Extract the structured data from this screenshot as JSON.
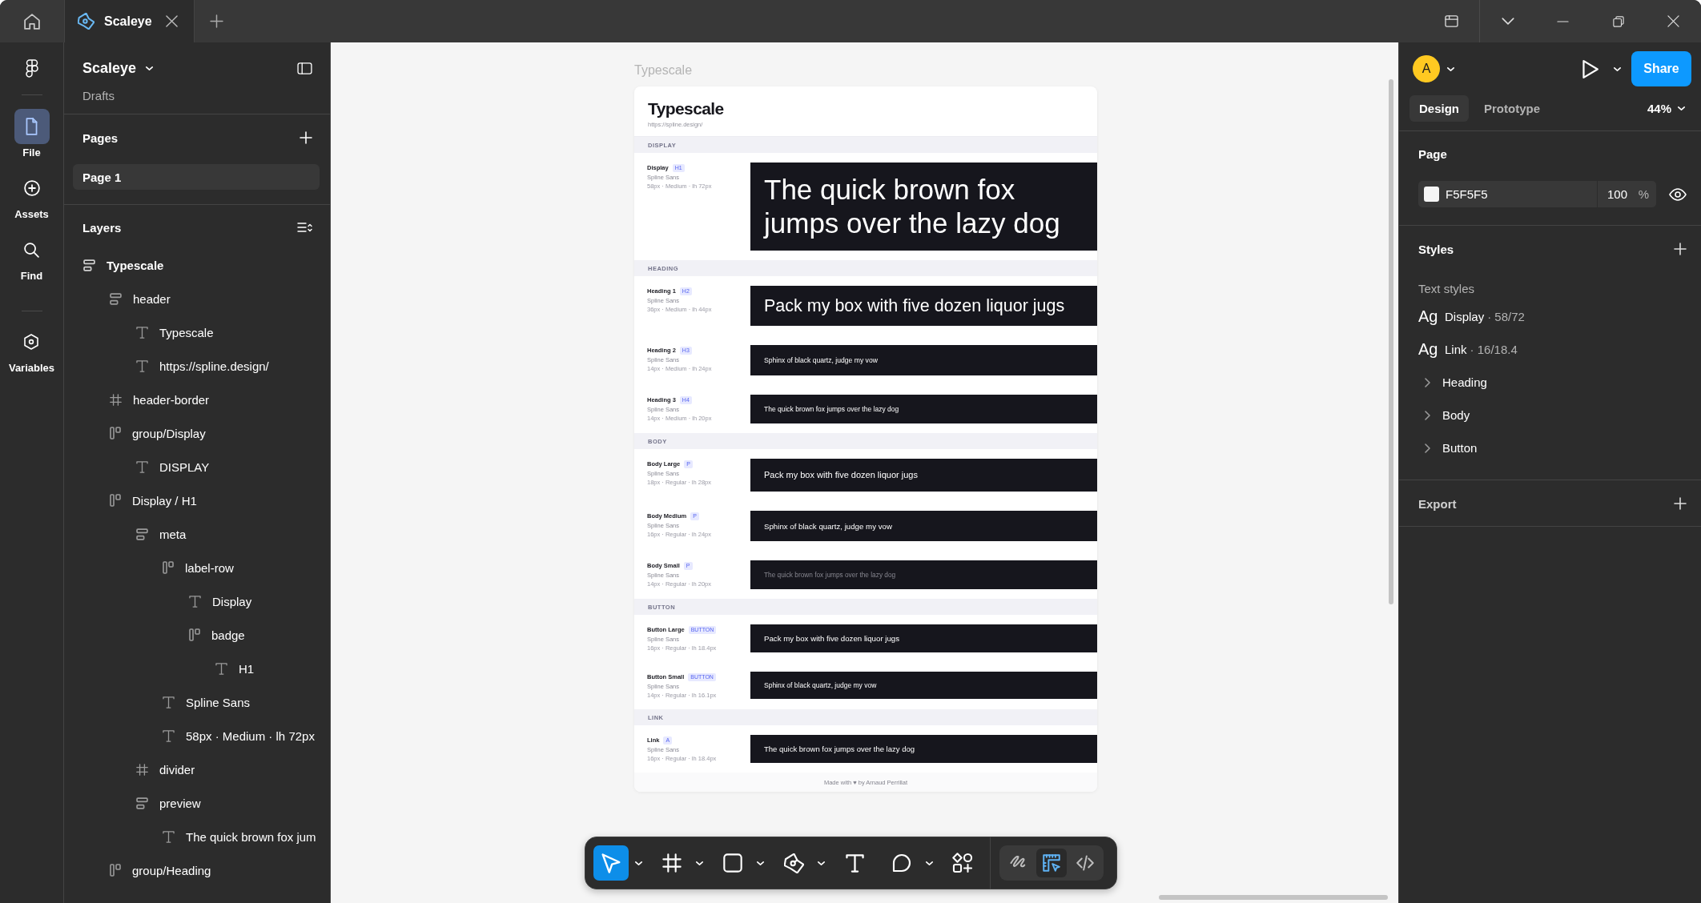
{
  "title_bar": {
    "tabs": [
      {
        "label": "Scaleye",
        "selected": true
      }
    ]
  },
  "rail": {
    "items": [
      {
        "kind": "file",
        "label": "File",
        "selected": true
      },
      {
        "kind": "assets",
        "label": "Assets",
        "selected": false
      },
      {
        "kind": "find",
        "label": "Find",
        "selected": false
      },
      {
        "kind": "variables",
        "label": "Variables",
        "selected": false
      }
    ]
  },
  "sidebar": {
    "file_name": "Scaleye",
    "location": "Drafts",
    "pages_title": "Pages",
    "pages": [
      {
        "label": "Page 1",
        "selected": true
      }
    ],
    "layers_title": "Layers",
    "layers": [
      {
        "kind": "vstack",
        "name": "Typescale",
        "children": [
          {
            "kind": "vstack",
            "name": "header",
            "children": [
              {
                "kind": "text",
                "name": "Typescale"
              },
              {
                "kind": "text",
                "name": "https://spline.design/"
              }
            ]
          },
          {
            "kind": "frame",
            "name": "header-border"
          },
          {
            "kind": "hstack",
            "name": "group/Display",
            "children": [
              {
                "kind": "text",
                "name": "DISPLAY"
              }
            ]
          },
          {
            "kind": "hstack",
            "name": "Display / H1",
            "children": [
              {
                "kind": "vstack",
                "name": "meta",
                "children": [
                  {
                    "kind": "hstack",
                    "name": "label-row",
                    "children": [
                      {
                        "kind": "text",
                        "name": "Display"
                      },
                      {
                        "kind": "hstack",
                        "name": "badge",
                        "children": [
                          {
                            "kind": "text",
                            "name": "H1"
                          }
                        ]
                      }
                    ]
                  },
                  {
                    "kind": "text",
                    "name": "Spline Sans"
                  },
                  {
                    "kind": "text",
                    "name": "58px · Medium · lh 72px"
                  }
                ]
              },
              {
                "kind": "frame",
                "name": "divider"
              },
              {
                "kind": "vstack",
                "name": "preview",
                "children": [
                  {
                    "kind": "text",
                    "name": "The quick brown fox jum"
                  }
                ]
              }
            ]
          },
          {
            "kind": "hstack",
            "name": "group/Heading"
          }
        ]
      }
    ]
  },
  "canvas": {
    "frame_label": "Typescale",
    "frame": {
      "title": "Typescale",
      "url": "https://spline.design/",
      "sections": [
        {
          "label": "DISPLAY",
          "rows": [
            {
              "name": "Display",
              "tag": "H1",
              "font": "Spline Sans",
              "spec": "58px · Medium · lh 72px",
              "sample": "The quick brown fox jumps over the lazy dog",
              "dimmed": false
            }
          ]
        },
        {
          "label": "HEADING",
          "rows": [
            {
              "name": "Heading 1",
              "tag": "H2",
              "font": "Spline Sans",
              "spec": "36px · Medium · lh 44px",
              "sample": "Pack my box with five dozen liquor jugs",
              "dimmed": false
            },
            {
              "name": "Heading 2",
              "tag": "H3",
              "font": "Spline Sans",
              "spec": "14px · Medium · lh 24px",
              "sample": "Sphinx of black quartz, judge my vow",
              "dimmed": false
            },
            {
              "name": "Heading 3",
              "tag": "H4",
              "font": "Spline Sans",
              "spec": "14px · Medium · lh 20px",
              "sample": "The quick brown fox jumps over the lazy dog",
              "dimmed": false
            }
          ]
        },
        {
          "label": "BODY",
          "rows": [
            {
              "name": "Body Large",
              "tag": "P",
              "font": "Spline Sans",
              "spec": "18px · Regular · lh 28px",
              "sample": "Pack my box with five dozen liquor jugs",
              "dimmed": false
            },
            {
              "name": "Body Medium",
              "tag": "P",
              "font": "Spline Sans",
              "spec": "16px · Regular · lh 24px",
              "sample": "Sphinx of black quartz, judge my vow",
              "dimmed": false
            },
            {
              "name": "Body Small",
              "tag": "P",
              "font": "Spline Sans",
              "spec": "14px · Regular · lh 20px",
              "sample": "The quick brown fox jumps over the lazy dog",
              "dimmed": true
            }
          ]
        },
        {
          "label": "BUTTON",
          "rows": [
            {
              "name": "Button Large",
              "tag": "BUTTON",
              "font": "Spline Sans",
              "spec": "16px · Regular · lh 18.4px",
              "sample": "Pack my box with five dozen liquor jugs",
              "dimmed": false
            },
            {
              "name": "Button Small",
              "tag": "BUTTON",
              "font": "Spline Sans",
              "spec": "14px · Regular · lh 16.1px",
              "sample": "Sphinx of black quartz, judge my vow",
              "dimmed": false
            }
          ]
        },
        {
          "label": "LINK",
          "rows": [
            {
              "name": "Link",
              "tag": "A",
              "font": "Spline Sans",
              "spec": "16px · Regular · lh 18.4px",
              "sample": "The quick brown fox jumps over the lazy dog",
              "dimmed": false
            }
          ]
        }
      ],
      "footer": "Made with ♥ by Arnaud Perrillat"
    }
  },
  "toolbar": {
    "tools": [
      {
        "kind": "move",
        "selected": true,
        "dropdown": true
      },
      {
        "kind": "frame",
        "selected": false,
        "dropdown": true
      },
      {
        "kind": "shape",
        "selected": false,
        "dropdown": true
      },
      {
        "kind": "pen",
        "selected": false,
        "dropdown": true
      },
      {
        "kind": "text",
        "selected": false,
        "dropdown": false
      },
      {
        "kind": "comment",
        "selected": false,
        "dropdown": true
      },
      {
        "kind": "actions",
        "selected": false,
        "dropdown": false
      }
    ],
    "modes": [
      {
        "kind": "draw",
        "selected": false
      },
      {
        "kind": "design",
        "selected": true
      },
      {
        "kind": "dev",
        "selected": false
      }
    ]
  },
  "inspector": {
    "avatar": "A",
    "share": "Share",
    "tabs": [
      {
        "label": "Design",
        "selected": true
      },
      {
        "label": "Prototype",
        "selected": false
      }
    ],
    "zoom": "44%",
    "page": {
      "title": "Page",
      "fill": "F5F5F5",
      "opacity": "100",
      "unit": "%"
    },
    "styles": {
      "title": "Styles",
      "subtitle": "Text styles",
      "items": [
        {
          "sample": "Ag",
          "name": "Display",
          "meta": "· 58/72"
        },
        {
          "sample": "Ag",
          "name": "Link",
          "meta": "· 16/18.4"
        }
      ],
      "groups": [
        {
          "label": "Heading",
          "expanded": false
        },
        {
          "label": "Body",
          "expanded": false
        },
        {
          "label": "Button",
          "expanded": false
        }
      ]
    },
    "export": {
      "title": "Export"
    }
  }
}
